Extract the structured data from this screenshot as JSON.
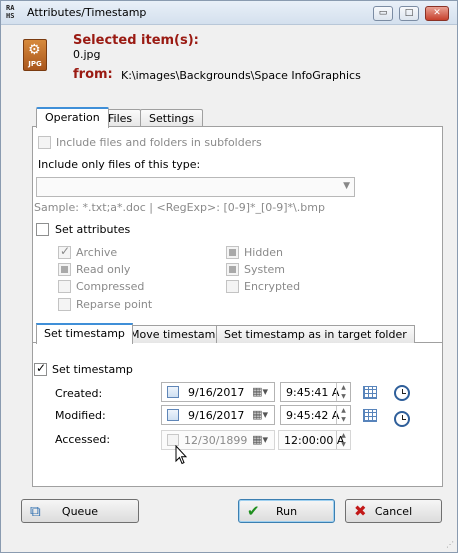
{
  "window": {
    "title": "Attributes/Timestamp",
    "logo_letters": [
      "RA",
      "HS"
    ],
    "minimize": "▭",
    "maximize": "□",
    "close": "✕"
  },
  "header": {
    "selected_label": "Selected item(s):",
    "selected_file": "0.jpg",
    "file_ext": "JPG",
    "from_label": "from:",
    "from_path": "K:\\images\\Backgrounds\\Space InfoGraphics"
  },
  "tabs": [
    {
      "label": "Operation",
      "active": true
    },
    {
      "label": "Files",
      "active": false
    },
    {
      "label": "Settings",
      "active": false
    }
  ],
  "operation": {
    "include_subfolders": {
      "label": "Include files and folders in subfolders",
      "checked": false,
      "enabled": false
    },
    "include_only_label": "Include only files of this type:",
    "file_type_value": "",
    "sample_text": "Sample: *.txt;a*.doc | <RegExp>: [0-9]*_[0-9]*\\.bmp",
    "set_attributes": {
      "label": "Set attributes",
      "checked": false
    },
    "attributes": [
      {
        "label": "Archive",
        "state": "checked"
      },
      {
        "label": "Read only",
        "state": "indeterminate"
      },
      {
        "label": "Compressed",
        "state": "unchecked"
      },
      {
        "label": "Reparse point",
        "state": "unchecked"
      },
      {
        "label": "Hidden",
        "state": "indeterminate"
      },
      {
        "label": "System",
        "state": "indeterminate"
      },
      {
        "label": "Encrypted",
        "state": "unchecked"
      }
    ]
  },
  "subtabs": [
    {
      "label": "Set timestamp",
      "active": true
    },
    {
      "label": "Move timestamp",
      "active": false
    },
    {
      "label": "Set timestamp as in target folder",
      "active": false
    }
  ],
  "timestamp": {
    "set_timestamp": {
      "label": "Set timestamp",
      "checked": true
    },
    "rows": [
      {
        "label": "Created:",
        "date": "9/16/2017",
        "time": "9:45:41 A",
        "enabled": true
      },
      {
        "label": "Modified:",
        "date": "9/16/2017",
        "time": "9:45:42 A",
        "enabled": true
      },
      {
        "label": "Accessed:",
        "date": "12/30/1899",
        "time": "12:00:00 A",
        "enabled": false
      }
    ]
  },
  "buttons": {
    "queue": "Queue",
    "run": "Run",
    "cancel": "Cancel"
  },
  "icons": {
    "file": "jpg-file-icon",
    "calendar": "calendar-dropdown-icon",
    "grid": "calendar-grid-icon",
    "clock": "clock-icon",
    "queue": "queue-icon",
    "run": "checkmark-icon",
    "cancel": "x-icon"
  },
  "colors": {
    "accent_red": "#9a1a12",
    "tab_blue": "#3f8fd8",
    "run_green": "#1f8f1f",
    "cancel_red": "#c21818"
  }
}
